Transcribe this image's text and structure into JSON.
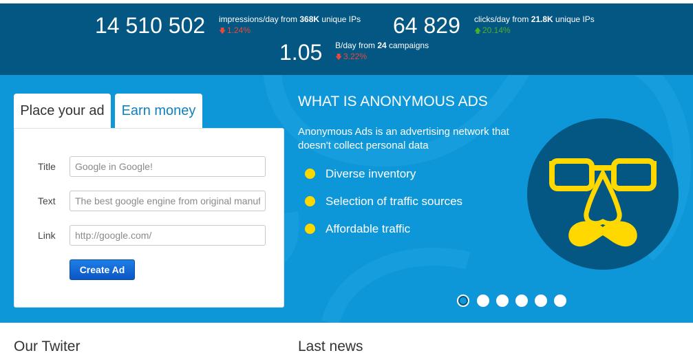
{
  "stats": {
    "impressions": {
      "value": "14 510 502",
      "label_pre": "impressions/day from ",
      "label_bold": "368K",
      "label_post": " unique IPs",
      "delta": "1.24%",
      "direction": "down"
    },
    "clicks": {
      "value": "64 829",
      "label_pre": "clicks/day from ",
      "label_bold": "21.8K",
      "label_post": " unique IPs",
      "delta": "20.14%",
      "direction": "up"
    },
    "price": {
      "value": "1.05",
      "label_pre": "B/day from ",
      "label_bold": "24",
      "label_post": " campaigns",
      "delta": "3.22%",
      "direction": "down"
    }
  },
  "tabs": [
    {
      "label": "Place your ad",
      "active": true
    },
    {
      "label": "Earn money",
      "active": false
    }
  ],
  "form": {
    "title": {
      "label": "Title",
      "placeholder": "Google in Google!"
    },
    "text": {
      "label": "Text",
      "placeholder": "The best google engine from original manufacturer"
    },
    "link": {
      "label": "Link",
      "placeholder": "http://google.com/"
    },
    "submit_label": "Create Ad"
  },
  "about": {
    "title": "WHAT IS ANONYMOUS ADS",
    "intro": "Anonymous Ads is an advertising network that doesn't collect personal data",
    "features": [
      "Diverse inventory",
      "Selection of traffic sources",
      "Affordable traffic"
    ]
  },
  "slider": {
    "count": 6,
    "active_index": 0
  },
  "bottom": {
    "twitter_title": "Our Twiter",
    "news_title": "Last news"
  },
  "colors": {
    "stats_bg": "#045783",
    "hero_bg": "#0e97d8",
    "accent_yellow": "#ffd800",
    "up": "#4caf2c",
    "down": "#e64a3b",
    "link_blue": "#0e7fc0"
  },
  "icons": {
    "down": "arrow-down-icon",
    "up": "arrow-up-icon",
    "bullet": "yellow-dot-icon",
    "mascot": "disguise-glasses-mustache-icon"
  }
}
